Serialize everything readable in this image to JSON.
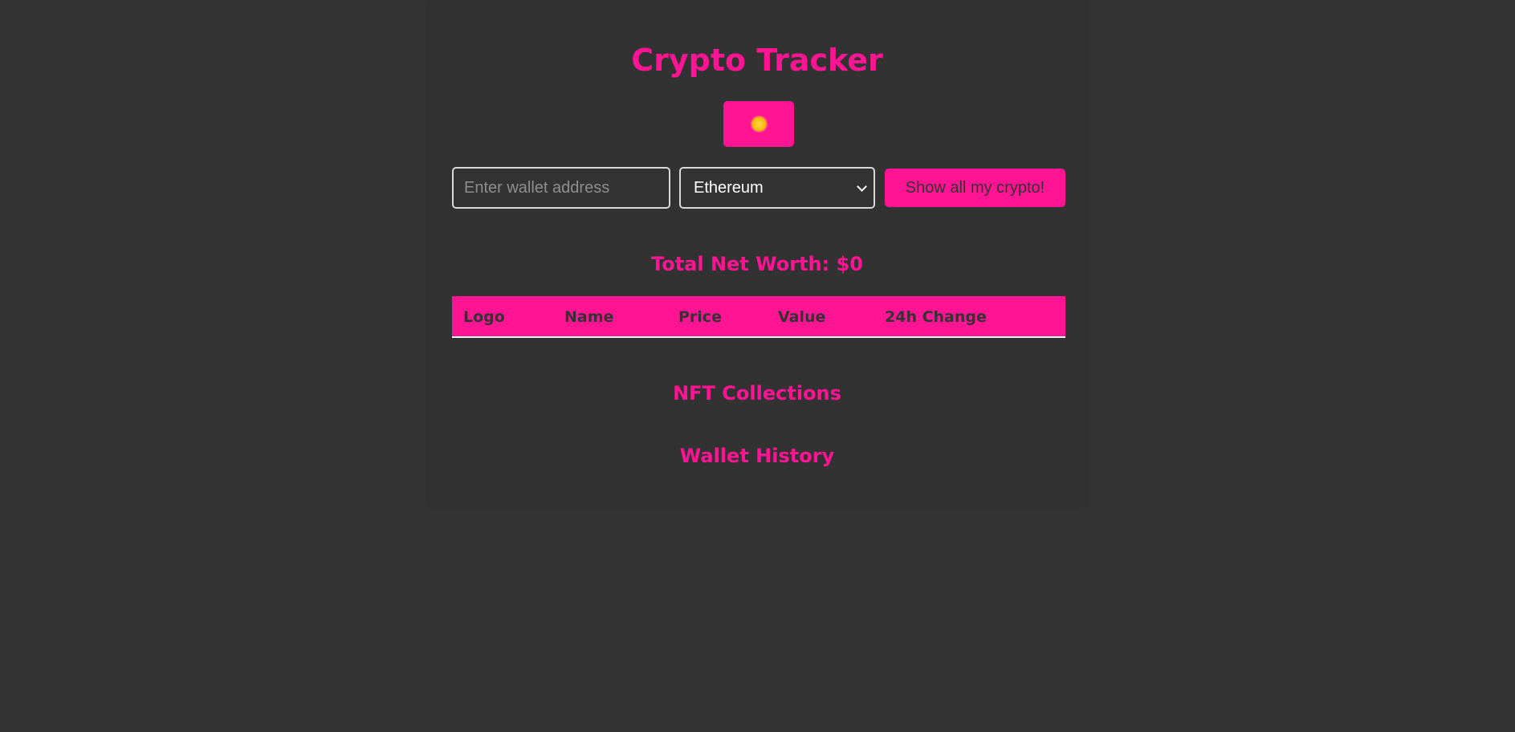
{
  "app": {
    "title": "Crypto Tracker"
  },
  "theme_toggle": {
    "icon": "sun-icon"
  },
  "search": {
    "placeholder": "Enter wallet address",
    "value": ""
  },
  "chain_select": {
    "selected": "Ethereum"
  },
  "actions": {
    "show_label": "Show all my crypto!"
  },
  "summary": {
    "net_worth_text": "Total Net Worth: $0"
  },
  "table": {
    "columns": [
      "Logo",
      "Name",
      "Price",
      "Value",
      "24h Change"
    ],
    "rows": []
  },
  "sections": {
    "nft_title": "NFT Collections",
    "history_title": "Wallet History"
  },
  "colors": {
    "background": "#333333",
    "accent": "#ff1493",
    "text_dark": "#333333",
    "border": "#d9d9d9"
  }
}
